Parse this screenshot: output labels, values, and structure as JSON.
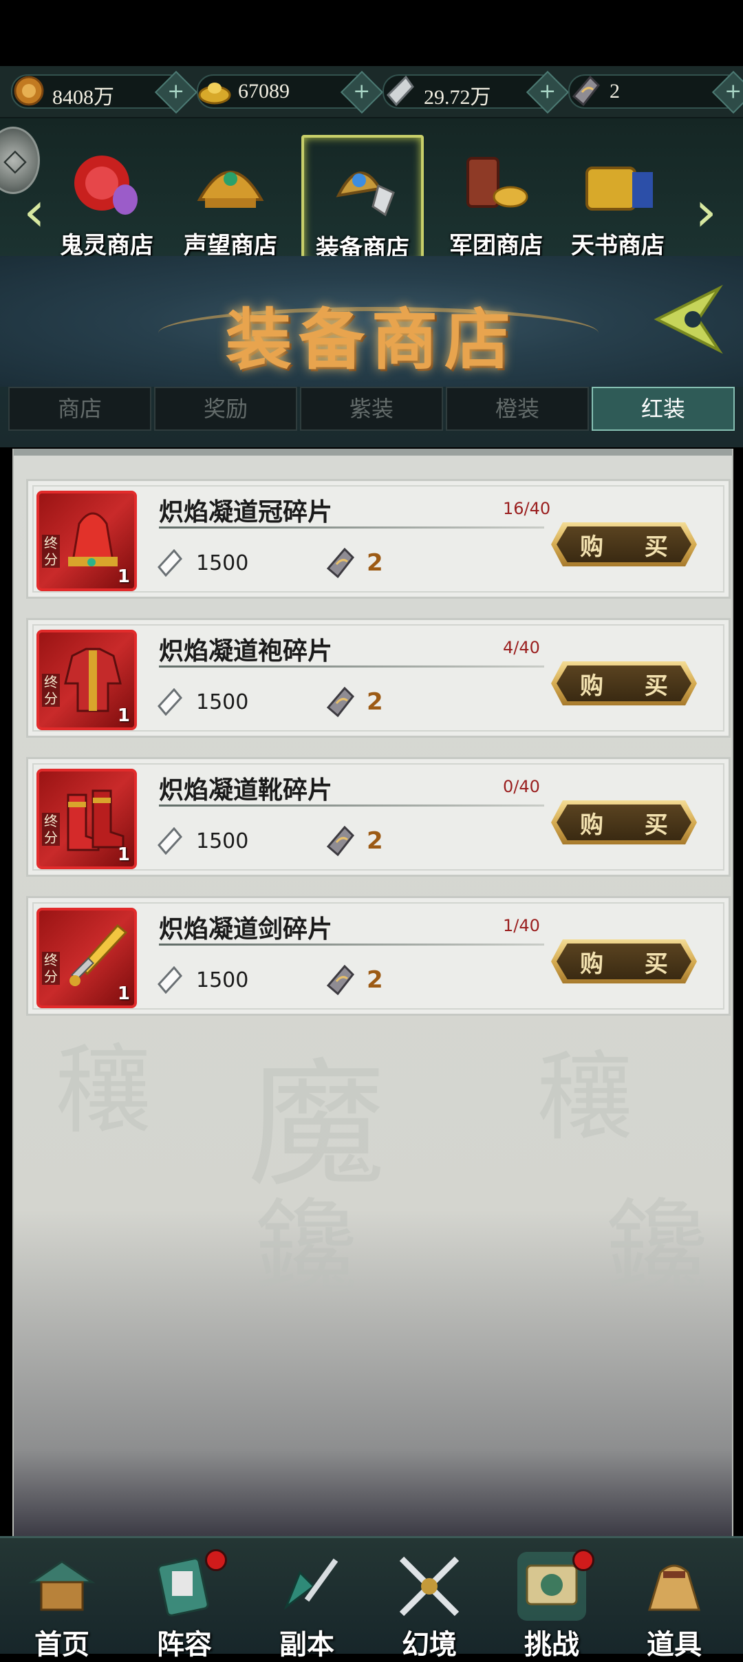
{
  "currencies": [
    {
      "name": "coin-icon",
      "value": "8408万",
      "color": "#c27a21"
    },
    {
      "name": "gold-ingot-icon",
      "value": "67089",
      "color": "#d8a92a"
    },
    {
      "name": "crystal-icon",
      "value": "29.72万",
      "color": "#d0d4d6"
    },
    {
      "name": "dark-crystal-icon",
      "value": "2",
      "color": "#8f8c93"
    }
  ],
  "shop_tabs": [
    {
      "label": "鬼灵商店",
      "icon": "spirit-orb-icon"
    },
    {
      "label": "声望商店",
      "icon": "golden-helmet-icon"
    },
    {
      "label": "装备商店",
      "icon": "equipment-icon"
    },
    {
      "label": "军团商店",
      "icon": "legion-icon"
    },
    {
      "label": "天书商店",
      "icon": "heaven-book-icon"
    }
  ],
  "banner": {
    "title": "装备商店"
  },
  "sub_tabs": [
    "商店",
    "奖励",
    "紫装",
    "橙装",
    "红装"
  ],
  "active_sub_tab": 4,
  "item_tag": "终分",
  "buy_label": "购 买",
  "items": [
    {
      "name": "炽焰凝道冠碎片",
      "progress": "16/40",
      "qty": "1",
      "cost1": "1500",
      "cost2": "2",
      "icon": "crown-icon"
    },
    {
      "name": "炽焰凝道袍碎片",
      "progress": "4/40",
      "qty": "1",
      "cost1": "1500",
      "cost2": "2",
      "icon": "robe-icon"
    },
    {
      "name": "炽焰凝道靴碎片",
      "progress": "0/40",
      "qty": "1",
      "cost1": "1500",
      "cost2": "2",
      "icon": "boots-icon"
    },
    {
      "name": "炽焰凝道剑碎片",
      "progress": "1/40",
      "qty": "1",
      "cost1": "1500",
      "cost2": "2",
      "icon": "sword-icon"
    }
  ],
  "nav": [
    {
      "label": "首页",
      "icon": "home-pavilion-icon"
    },
    {
      "label": "阵容",
      "icon": "lineup-icon"
    },
    {
      "label": "副本",
      "icon": "dungeon-sword-icon"
    },
    {
      "label": "幻境",
      "icon": "crossed-swords-icon"
    },
    {
      "label": "挑战",
      "icon": "challenge-scroll-icon"
    },
    {
      "label": "道具",
      "icon": "item-bag-icon"
    }
  ]
}
